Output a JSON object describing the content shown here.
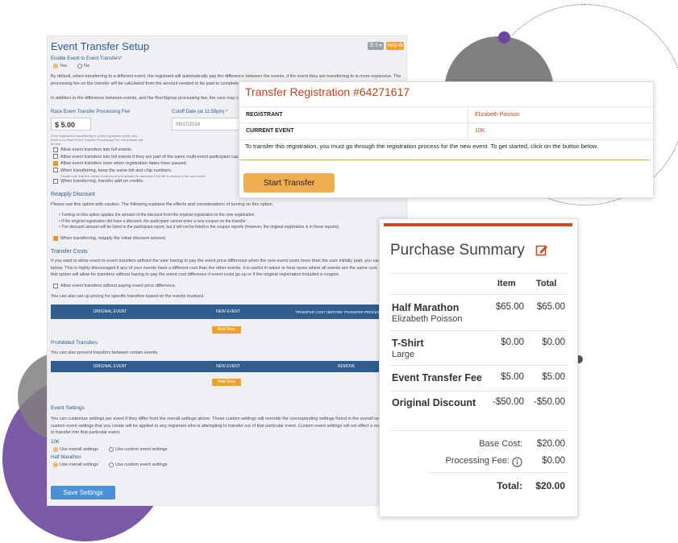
{
  "settings": {
    "title": "Event Transfer Setup",
    "toolbar": {
      "tools_label": "☰ 0 ▾",
      "help_label": "Help ✪"
    },
    "enable_label": "Enable Event to Event Transfers*",
    "yes_label": "Yes",
    "no_label": "No",
    "default_text_1": "By default, when transferring to a different event, the registrant will automatically pay the difference between the events, if the event they are transferring to is more expensive. The",
    "default_text_2": "processing fee on the transfer will be calculated from the amount needed to be paid to complete the",
    "addition_text": "In addition to the difference between events, and the RunSignup processing fee, the race may charge",
    "fee_label": "Race Event Transfer Processing Fee",
    "fee_value": "$ 5.00",
    "cutoff_label": "Cutoff Date (at 11:59pm) *",
    "cutoff_value": "09/17/2024",
    "fee_note_1": "If the registrant is transferring to a less expensive event, and",
    "fee_note_2": "there is no Race Event Transfer Processing Fee, the transfer will",
    "fee_note_3": "be free.",
    "options": [
      {
        "label": "Allow event transfers into full events.",
        "checked": false
      },
      {
        "label": "Allow event transfers into full events if they are part of the same multi-event participant cap.",
        "checked": false
      },
      {
        "label": "Allow event transfers even when registration dates have passed.",
        "checked": true
      },
      {
        "label": "When transferring, keep the same bib and chip numbers.",
        "checked": false
      }
    ],
    "bib_note": "Please note that this option could result in duplicate bib numbers if the bib is already in the new event.",
    "addon_label": "When transferring, transfer add-on credits.",
    "reapply_title": "Reapply Discount",
    "reapply_caution": "Please use this option with caution. The following explains the effects and considerations of turning on this option.",
    "reapply_bullets": [
      "• Turning on this option applies the amount of the discount from the original registration to the new registration.",
      "• If the original registration did have a discount, the participant cannot enter a new coupon on the transfer.",
      "• The discount amount will be listed in the participant report, but it will not be listed in the coupon reports (however, the original registration is in these reports)."
    ],
    "reapply_checkbox": "When transferring, reapply the initial discount amount.",
    "costs_title": "Transfer Costs",
    "costs_text_1": "If you want to allow event to event transfers without the user having to pay the event price difference when the new event costs more than the user initially paid, you can enab",
    "costs_text_2": "below. This is highly discouraged if any of your events have a different cost than the other events. It is useful in waive or heat races where all events are the same cost. In this",
    "costs_text_3": "this option will allow for transfers without having to pay the event cost difference if event costs go up or if the original registration included a coupon.",
    "costs_checkbox": "Allow event transfers without paying event price difference.",
    "costs_pricing": "You can also set up pricing for specific transfers based on the events involved.",
    "costs_cols": [
      "ORIGINAL EVENT",
      "NEW EVENT",
      "TRANSFER COST (BEFORE TRANSFER PROCESSING FEE)"
    ],
    "add_row": "Add Row",
    "prohibited_title": "Prohibited Transfers",
    "prohibited_text": "You can also prevent transfers between certain events.",
    "prohibited_cols": [
      "ORIGINAL EVENT",
      "NEW EVENT",
      "REMOVE"
    ],
    "event_settings_title": "Event Settings",
    "event_settings_text_1": "You can customize settings per event if they differ from the overall settings above. These custom settings will override the corresponding settings found in the overall settin",
    "event_settings_text_2": "custom event settings that you create will be applied to any registrant who is attempting to transfer out of that particular event. Custom event settings will not effect a regist",
    "event_settings_text_3": "to transfer into that particular event.",
    "events": [
      {
        "name": "10K",
        "overall": "Use overall settings",
        "custom": "Use custom event settings"
      },
      {
        "name": "Half Marathon",
        "overall": "Use overall settings",
        "custom": "Use custom event settings"
      }
    ],
    "save_label": "Save Settings"
  },
  "transfer": {
    "title": "Transfer Registration #64271617",
    "registrant_label": "REGISTRANT",
    "registrant_value": "Elizabeth Poisson",
    "event_label": "CURRENT EVENT",
    "event_value": "10K",
    "instructions": "To transfer this registration, you must go through the registration process for the new event. To get started, click on the button below.",
    "button_label": "Start Transfer"
  },
  "summary": {
    "title": "Purchase Summary",
    "col_item": "Item",
    "col_total": "Total",
    "lines": [
      {
        "name": "Half Marathon",
        "sub": "Elizabeth Poisson",
        "item": "$65.00",
        "total": "$65.00"
      },
      {
        "name": "T-Shirt",
        "sub": "Large",
        "item": "$0.00",
        "total": "$0.00"
      },
      {
        "name": "Event Transfer Fee",
        "sub": "",
        "item": "$5.00",
        "total": "$5.00"
      },
      {
        "name": "Original Discount",
        "sub": "",
        "item": "-$50.00",
        "total": "-$50.00"
      }
    ],
    "base_cost_label": "Base Cost:",
    "base_cost_value": "$20.00",
    "processing_label": "Processing Fee:",
    "processing_value": "$0.00",
    "total_label": "Total:",
    "total_value": "$20.00"
  },
  "colors": {
    "accent": "#f0a030",
    "brand_blue": "#2f5d8e",
    "title_red": "#b8461c"
  },
  "icons": {
    "edit": "edit-icon",
    "info": "info-icon"
  }
}
